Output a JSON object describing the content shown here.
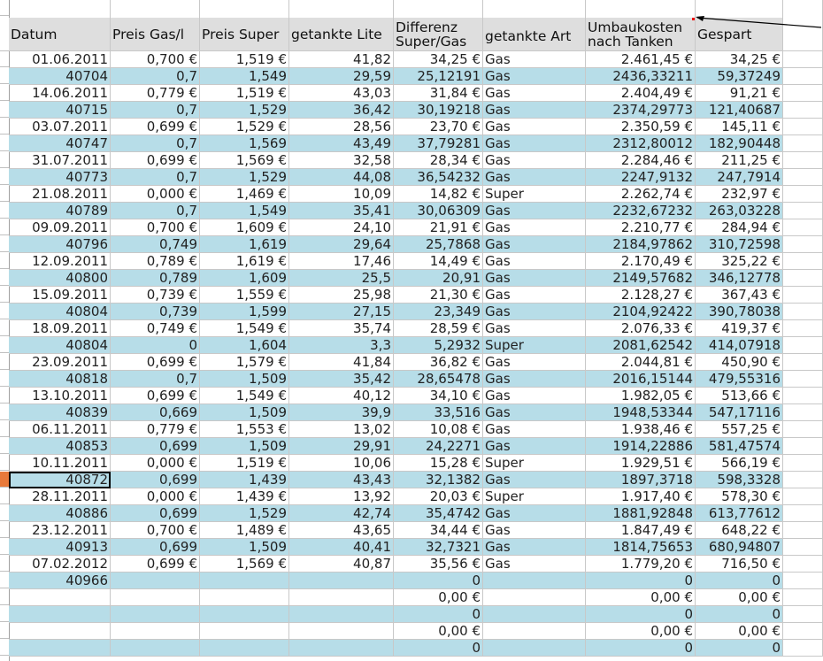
{
  "headers": [
    "Datum",
    "Preis Gas/l",
    "Preis Super",
    "getankte Liter",
    "Differenz Super/Gas",
    "getankte Art",
    "Umbaukosten nach Tanken",
    "Gespart"
  ],
  "header_lines": {
    "differenz": [
      "Differenz",
      "Super/Gas"
    ],
    "umbau": [
      "Umbaukosten",
      "nach Tanken"
    ]
  },
  "header_short": {
    "preis_super": "Preis Super",
    "getankte_liter": "getankte Lite"
  },
  "rows": [
    [
      "01.06.2011",
      "0,700 €",
      "1,519 €",
      "41,82",
      "34,25 €",
      "Gas",
      "2.461,45 €",
      "34,25 €"
    ],
    [
      "40704",
      "0,7",
      "1,549",
      "29,59",
      "25,12191",
      "Gas",
      "2436,33211",
      "59,37249"
    ],
    [
      "14.06.2011",
      "0,779 €",
      "1,519 €",
      "43,03",
      "31,84 €",
      "Gas",
      "2.404,49 €",
      "91,21 €"
    ],
    [
      "40715",
      "0,7",
      "1,529",
      "36,42",
      "30,19218",
      "Gas",
      "2374,29773",
      "121,40687"
    ],
    [
      "03.07.2011",
      "0,699 €",
      "1,529 €",
      "28,56",
      "23,70 €",
      "Gas",
      "2.350,59 €",
      "145,11 €"
    ],
    [
      "40747",
      "0,7",
      "1,569",
      "43,49",
      "37,79281",
      "Gas",
      "2312,80012",
      "182,90448"
    ],
    [
      "31.07.2011",
      "0,699 €",
      "1,569 €",
      "32,58",
      "28,34 €",
      "Gas",
      "2.284,46 €",
      "211,25 €"
    ],
    [
      "40773",
      "0,7",
      "1,529",
      "44,08",
      "36,54232",
      "Gas",
      "2247,9132",
      "247,7914"
    ],
    [
      "21.08.2011",
      "0,000 €",
      "1,469 €",
      "10,09",
      "14,82 €",
      "Super",
      "2.262,74 €",
      "232,97 €"
    ],
    [
      "40789",
      "0,7",
      "1,549",
      "35,41",
      "30,06309",
      "Gas",
      "2232,67232",
      "263,03228"
    ],
    [
      "09.09.2011",
      "0,700 €",
      "1,609 €",
      "24,10",
      "21,91 €",
      "Gas",
      "2.210,77 €",
      "284,94 €"
    ],
    [
      "40796",
      "0,749",
      "1,619",
      "29,64",
      "25,7868",
      "Gas",
      "2184,97862",
      "310,72598"
    ],
    [
      "12.09.2011",
      "0,789 €",
      "1,619 €",
      "17,46",
      "14,49 €",
      "Gas",
      "2.170,49 €",
      "325,22 €"
    ],
    [
      "40800",
      "0,789",
      "1,609",
      "25,5",
      "20,91",
      "Gas",
      "2149,57682",
      "346,12778"
    ],
    [
      "15.09.2011",
      "0,739 €",
      "1,559 €",
      "25,98",
      "21,30 €",
      "Gas",
      "2.128,27 €",
      "367,43 €"
    ],
    [
      "40804",
      "0,739",
      "1,599",
      "27,15",
      "23,349",
      "Gas",
      "2104,92422",
      "390,78038"
    ],
    [
      "18.09.2011",
      "0,749 €",
      "1,549 €",
      "35,74",
      "28,59 €",
      "Gas",
      "2.076,33 €",
      "419,37 €"
    ],
    [
      "40804",
      "0",
      "1,604",
      "3,3",
      "5,2932",
      "Super",
      "2081,62542",
      "414,07918"
    ],
    [
      "23.09.2011",
      "0,699 €",
      "1,579 €",
      "41,84",
      "36,82 €",
      "Gas",
      "2.044,81 €",
      "450,90 €"
    ],
    [
      "40818",
      "0,7",
      "1,509",
      "35,42",
      "28,65478",
      "Gas",
      "2016,15144",
      "479,55316"
    ],
    [
      "13.10.2011",
      "0,699 €",
      "1,549 €",
      "40,12",
      "34,10 €",
      "Gas",
      "1.982,05 €",
      "513,66 €"
    ],
    [
      "40839",
      "0,669",
      "1,509",
      "39,9",
      "33,516",
      "Gas",
      "1948,53344",
      "547,17116"
    ],
    [
      "06.11.2011",
      "0,779 €",
      "1,553 €",
      "13,02",
      "10,08 €",
      "Gas",
      "1.938,46 €",
      "557,25 €"
    ],
    [
      "40853",
      "0,699",
      "1,509",
      "29,91",
      "24,2271",
      "Gas",
      "1914,22886",
      "581,47574"
    ],
    [
      "10.11.2011",
      "0,000 €",
      "1,519 €",
      "10,06",
      "15,28 €",
      "Super",
      "1.929,51 €",
      "566,19 €"
    ],
    [
      "40872",
      "0,699",
      "1,439",
      "43,43",
      "32,1382",
      "Gas",
      "1897,3718",
      "598,3328"
    ],
    [
      "28.11.2011",
      "0,000 €",
      "1,439 €",
      "13,92",
      "20,03 €",
      "Super",
      "1.917,40 €",
      "578,30 €"
    ],
    [
      "40886",
      "0,699",
      "1,529",
      "42,74",
      "35,4742",
      "Gas",
      "1881,92848",
      "613,77612"
    ],
    [
      "23.12.2011",
      "0,700 €",
      "1,489 €",
      "43,65",
      "34,44 €",
      "Gas",
      "1.847,49 €",
      "648,22 €"
    ],
    [
      "40913",
      "0,699",
      "1,509",
      "40,41",
      "32,7321",
      "Gas",
      "1814,75653",
      "680,94807"
    ],
    [
      "07.02.2012",
      "0,699 €",
      "1,569 €",
      "40,87",
      "35,56 €",
      "Gas",
      "1.779,20 €",
      "716,50 €"
    ],
    [
      "40966",
      "",
      "",
      "",
      "0",
      "",
      "0",
      "0"
    ],
    [
      "",
      "",
      "",
      "",
      "0,00 €",
      "",
      "0,00 €",
      "0,00 €"
    ],
    [
      "",
      "",
      "",
      "",
      "0",
      "",
      "0",
      "0"
    ],
    [
      "",
      "",
      "",
      "",
      "0,00 €",
      "",
      "0,00 €",
      "0,00 €"
    ],
    [
      "",
      "",
      "",
      "",
      "0",
      "",
      "0",
      "0"
    ]
  ],
  "active_row_index": 25,
  "colors": {
    "band": "#b7dde8",
    "header": "#dedede",
    "active_row_marker": "#e8793a",
    "comment_marker": "#e00000"
  }
}
